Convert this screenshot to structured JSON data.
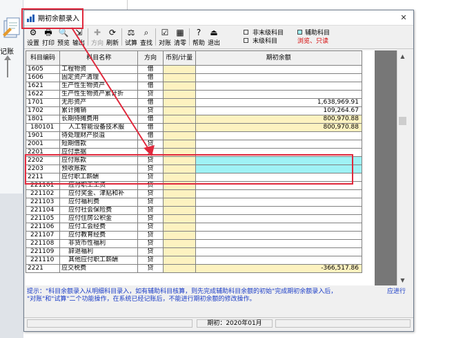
{
  "background": {
    "left_label": "记账"
  },
  "window": {
    "title": "期初余额录入",
    "close_glyph": "✕"
  },
  "toolbar": {
    "buttons": [
      {
        "label": "设置",
        "icon": "settings-icon",
        "glyph": "⚙"
      },
      {
        "label": "打印",
        "icon": "printer-icon",
        "glyph": "🖶"
      },
      {
        "label": "预览",
        "icon": "preview-icon",
        "glyph": "🔍"
      },
      {
        "label": "输出",
        "icon": "export-icon",
        "glyph": "⇲"
      },
      {
        "label": "方向",
        "icon": "direction-icon",
        "glyph": "✚",
        "disabled": true
      },
      {
        "label": "刷新",
        "icon": "refresh-icon",
        "glyph": "⟳"
      },
      {
        "label": "试算",
        "icon": "balance-scale-icon",
        "glyph": "⚖"
      },
      {
        "label": "查找",
        "icon": "find-icon",
        "glyph": "⌕"
      },
      {
        "label": "对账",
        "icon": "reconcile-icon",
        "glyph": "☑"
      },
      {
        "label": "清零",
        "icon": "clear-zero-icon",
        "glyph": "▦"
      },
      {
        "label": "帮助",
        "icon": "help-icon",
        "glyph": "?"
      },
      {
        "label": "退出",
        "icon": "exit-icon",
        "glyph": "⏏"
      }
    ],
    "legend": {
      "non_leaf": "非末级科目",
      "leaf": "末级科目",
      "auxiliary": "辅助科目",
      "browse_readonly": "浏览、只读"
    }
  },
  "grid": {
    "headers": [
      "科目编码",
      "科目名称",
      "方向",
      "币别/计量",
      "期初余额"
    ],
    "rows": [
      {
        "code": "1605",
        "name": "工程物资",
        "dir": "借",
        "amount": "",
        "style": ""
      },
      {
        "code": "1606",
        "name": "固定资产清理",
        "dir": "借",
        "amount": "",
        "style": ""
      },
      {
        "code": "1621",
        "name": "生产性生物资产",
        "dir": "借",
        "amount": "",
        "style": ""
      },
      {
        "code": "1622",
        "name": "生产性生物资产累计折",
        "dir": "贷",
        "amount": "",
        "style": ""
      },
      {
        "code": "1701",
        "name": "无形资产",
        "dir": "借",
        "amount": "1,638,969.91",
        "style": ""
      },
      {
        "code": "1702",
        "name": "累计摊销",
        "dir": "贷",
        "amount": "109,264.67",
        "style": ""
      },
      {
        "code": "1801",
        "name": "长期待摊费用",
        "dir": "借",
        "amount": "800,970.88",
        "style": "yellow"
      },
      {
        "code": "180101",
        "name": "人工智能设备技术服",
        "dir": "借",
        "amount": "800,970.88",
        "style": "yellow",
        "indent": true
      },
      {
        "code": "1901",
        "name": "待处理财产损溢",
        "dir": "借",
        "amount": "",
        "style": ""
      },
      {
        "code": "2001",
        "name": "短期借款",
        "dir": "贷",
        "amount": "",
        "style": ""
      },
      {
        "code": "2201",
        "name": "应付票据",
        "dir": "贷",
        "amount": "",
        "style": ""
      },
      {
        "code": "2202",
        "name": "应付账款",
        "dir": "贷",
        "amount": "",
        "style": "cyan"
      },
      {
        "code": "2203",
        "name": "预收账款",
        "dir": "贷",
        "amount": "",
        "style": "cyan"
      },
      {
        "code": "2211",
        "name": "应付职工薪酬",
        "dir": "贷",
        "amount": "",
        "style": ""
      },
      {
        "code": "221101",
        "name": "应付职工工资",
        "dir": "贷",
        "amount": "",
        "style": "",
        "indent": true
      },
      {
        "code": "221102",
        "name": "应付奖金、津贴和补",
        "dir": "贷",
        "amount": "",
        "style": "",
        "indent": true
      },
      {
        "code": "221103",
        "name": "应付福利费",
        "dir": "贷",
        "amount": "",
        "style": "",
        "indent": true
      },
      {
        "code": "221104",
        "name": "应付社会保险费",
        "dir": "贷",
        "amount": "",
        "style": "",
        "indent": true
      },
      {
        "code": "221105",
        "name": "应付住房公积金",
        "dir": "贷",
        "amount": "",
        "style": "",
        "indent": true
      },
      {
        "code": "221106",
        "name": "应付工会经费",
        "dir": "贷",
        "amount": "",
        "style": "",
        "indent": true
      },
      {
        "code": "221107",
        "name": "应付教育经费",
        "dir": "贷",
        "amount": "",
        "style": "",
        "indent": true
      },
      {
        "code": "221108",
        "name": "非货币性福利",
        "dir": "贷",
        "amount": "",
        "style": "",
        "indent": true
      },
      {
        "code": "221109",
        "name": "辞退福利",
        "dir": "贷",
        "amount": "",
        "style": "",
        "indent": true
      },
      {
        "code": "221110",
        "name": "其他应付职工薪酬",
        "dir": "贷",
        "amount": "",
        "style": "",
        "indent": true
      },
      {
        "code": "2221",
        "name": "应交税费",
        "dir": "贷",
        "amount": "-366,517.86",
        "style": "yellow"
      }
    ]
  },
  "hint": {
    "line1": "提示：\"科目余额录入从明细科目录入，如有辅助科目核算，则先完成辅助科目余额的初始\"完成期初余额录入后，",
    "line2": "\"对账\"和\"试算\"二个功能操作，在系统已经记账后，不能进行期初余额的修改操作。",
    "right": "应进行"
  },
  "status": {
    "period": "期初：2020年01月"
  },
  "colors": {
    "annotation": "#e0283c",
    "yellow_cell": "#fdf2c0",
    "cyan_cell": "#9ff2f5",
    "hint_text": "#1a3cc7"
  }
}
